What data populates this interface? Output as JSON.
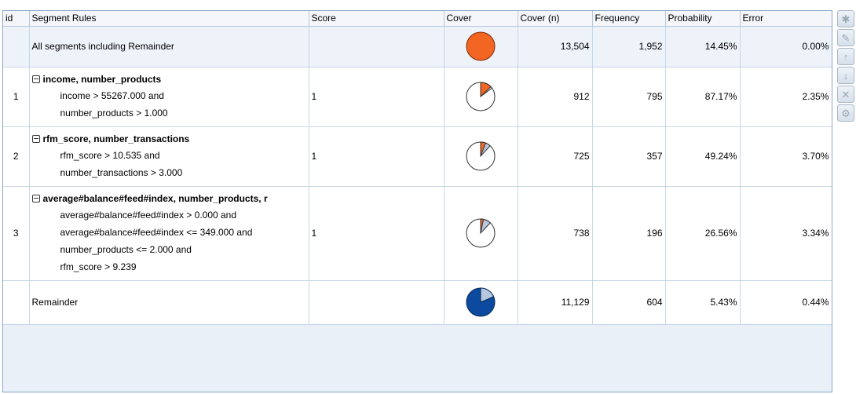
{
  "columns": {
    "id": "id",
    "rules": "Segment Rules",
    "score": "Score",
    "cover": "Cover",
    "cover_n": "Cover (n)",
    "frequency": "Frequency",
    "probability": "Probability",
    "error": "Error"
  },
  "rows": {
    "all": {
      "label": "All segments including Remainder",
      "cover_fraction": 1.0,
      "cover_n": "13,504",
      "frequency": "1,952",
      "probability": "14.45%",
      "error": "0.00%"
    },
    "r1": {
      "id": "1",
      "head": "income, number_products",
      "lines": [
        "income > 55267.000 and",
        "number_products > 1.000"
      ],
      "score": "1",
      "cover_fraction": 0.0675,
      "cover_n": "912",
      "frequency": "795",
      "probability": "87.17%",
      "error": "2.35%"
    },
    "r2": {
      "id": "2",
      "head": "rfm_score, number_transactions",
      "lines": [
        "rfm_score > 10.535 and",
        "number_transactions > 3.000"
      ],
      "score": "1",
      "cover_fraction": 0.0537,
      "cover_n": "725",
      "frequency": "357",
      "probability": "49.24%",
      "error": "3.70%"
    },
    "r3": {
      "id": "3",
      "head": "average#balance#feed#index, number_products, r",
      "lines": [
        "average#balance#feed#index > 0.000 and",
        "average#balance#feed#index <= 349.000 and",
        "number_products <= 2.000 and",
        "rfm_score > 9.239"
      ],
      "score": "1",
      "cover_fraction": 0.0547,
      "cover_n": "738",
      "frequency": "196",
      "probability": "26.56%",
      "error": "3.34%"
    },
    "remainder": {
      "label": "Remainder",
      "cover_fraction": 0.8241,
      "cover_n": "11,129",
      "frequency": "604",
      "probability": "5.43%",
      "error": "0.44%"
    }
  },
  "colors": {
    "orange": "#f26522",
    "blue": "#0b4a9e",
    "light_blue": "#b8c8dc",
    "header_bg": "#f4f6fa",
    "grid_line": "#c8d6e6"
  },
  "toolbar": {
    "icons": [
      "add-row-icon",
      "edit-icon",
      "move-up-icon",
      "move-down-icon",
      "delete-icon",
      "settings-icon"
    ]
  }
}
